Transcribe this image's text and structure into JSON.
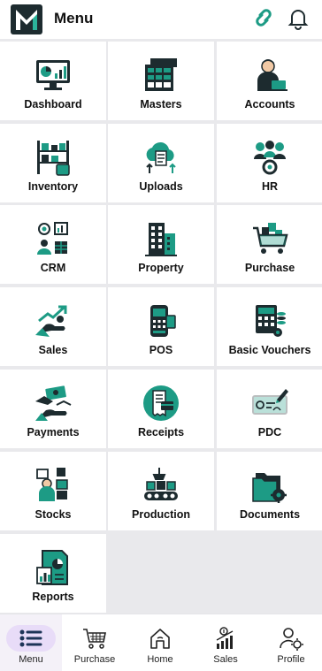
{
  "header": {
    "title": "Menu",
    "icons": {
      "logo": "m-logo",
      "link": "link-icon",
      "notifications": "bell-icon"
    }
  },
  "colors": {
    "accent": "#1d9b85",
    "dark": "#1d2b2f",
    "nav_active": "#e8dcf8"
  },
  "menu": {
    "tiles": [
      {
        "label": "Dashboard"
      },
      {
        "label": "Masters"
      },
      {
        "label": "Accounts"
      },
      {
        "label": "Inventory"
      },
      {
        "label": "Uploads"
      },
      {
        "label": "HR"
      },
      {
        "label": "CRM"
      },
      {
        "label": "Property"
      },
      {
        "label": "Purchase"
      },
      {
        "label": "Sales"
      },
      {
        "label": "POS"
      },
      {
        "label": "Basic Vouchers"
      },
      {
        "label": "Payments"
      },
      {
        "label": "Receipts"
      },
      {
        "label": "PDC"
      },
      {
        "label": "Stocks"
      },
      {
        "label": "Production"
      },
      {
        "label": "Documents"
      },
      {
        "label": "Reports"
      }
    ]
  },
  "bottom_nav": {
    "active": "Menu",
    "items": [
      {
        "label": "Menu",
        "icon": "list-icon"
      },
      {
        "label": "Purchase",
        "icon": "cart-icon"
      },
      {
        "label": "Home",
        "icon": "home-icon"
      },
      {
        "label": "Sales",
        "icon": "sales-chart-icon"
      },
      {
        "label": "Profile",
        "icon": "profile-settings-icon"
      }
    ]
  }
}
